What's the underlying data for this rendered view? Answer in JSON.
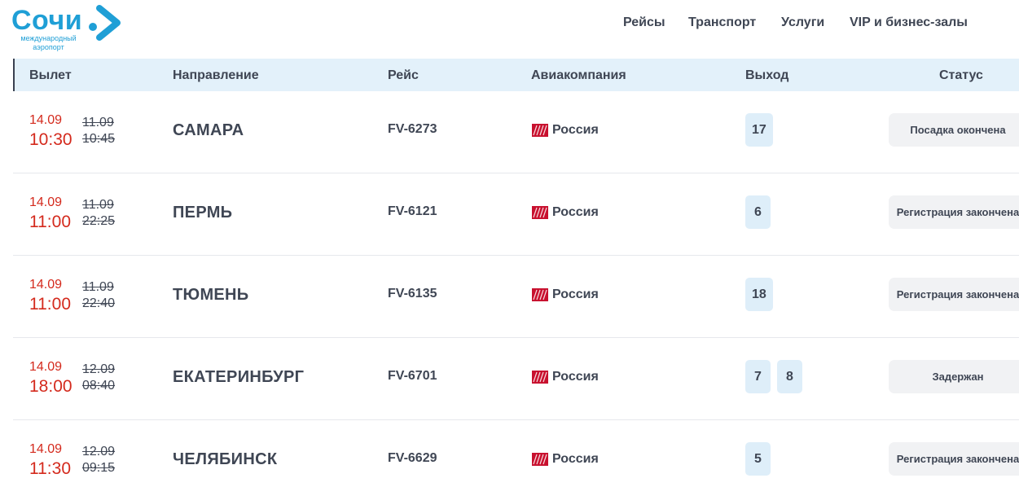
{
  "logo": {
    "word": "Сочи",
    "sub_line1": "международный",
    "sub_line2": "аэропорт",
    "color": "#1f9fd6"
  },
  "nav": [
    {
      "label": "Рейсы"
    },
    {
      "label": "Транспорт"
    },
    {
      "label": "Услуги"
    },
    {
      "label": "VIP и бизнес-залы"
    }
  ],
  "table": {
    "headers": {
      "departure": "Вылет",
      "destination": "Направление",
      "flight": "Рейс",
      "airline": "Авиакомпания",
      "gate": "Выход",
      "status": "Статус"
    },
    "rows": [
      {
        "date_new": "14.09",
        "time_new": "10:30",
        "date_old": "11.09",
        "time_old": "10:45",
        "destination": "САМАРА",
        "flight": "FV-6273",
        "airline": "Россия",
        "gates": [
          "17"
        ],
        "status": "Посадка окончена"
      },
      {
        "date_new": "14.09",
        "time_new": "11:00",
        "date_old": "11.09",
        "time_old": "22:25",
        "destination": "ПЕРМЬ",
        "flight": "FV-6121",
        "airline": "Россия",
        "gates": [
          "6"
        ],
        "status": "Регистрация закончена"
      },
      {
        "date_new": "14.09",
        "time_new": "11:00",
        "date_old": "11.09",
        "time_old": "22:40",
        "destination": "ТЮМЕНЬ",
        "flight": "FV-6135",
        "airline": "Россия",
        "gates": [
          "18"
        ],
        "status": "Регистрация закончена"
      },
      {
        "date_new": "14.09",
        "time_new": "18:00",
        "date_old": "12.09",
        "time_old": "08:40",
        "destination": "ЕКАТЕРИНБУРГ",
        "flight": "FV-6701",
        "airline": "Россия",
        "gates": [
          "7",
          "8"
        ],
        "status": "Задержан"
      },
      {
        "date_new": "14.09",
        "time_new": "11:30",
        "date_old": "12.09",
        "time_old": "09:15",
        "destination": "ЧЕЛЯБИНСК",
        "flight": "FV-6629",
        "airline": "Россия",
        "gates": [
          "5"
        ],
        "status": "Регистрация закончена"
      }
    ]
  },
  "colors": {
    "brand_blue": "#1f9fd6",
    "changed_time_red": "#d42a1d",
    "header_bg": "#e3f1fa",
    "gate_bg": "#deeef9",
    "status_bg": "#f1f2f4"
  },
  "icons": {
    "logo_arrow": "chevron-right-icon",
    "airline_logo": "rossiya-airline-logo"
  }
}
